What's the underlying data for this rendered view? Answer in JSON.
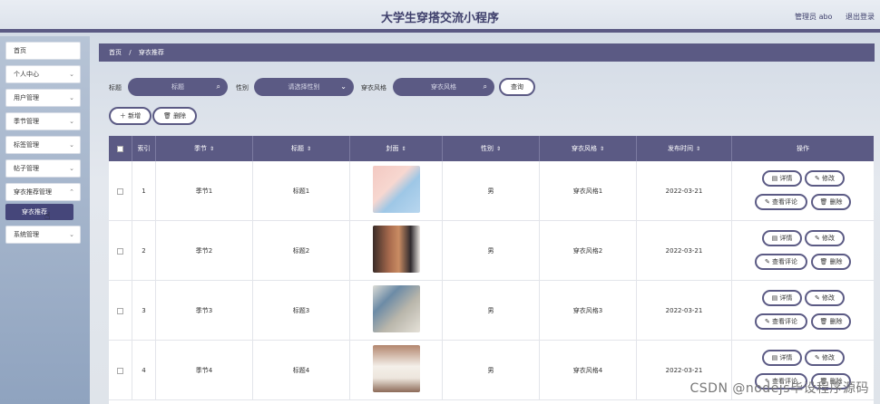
{
  "header": {
    "title": "大学生穿搭交流小程序",
    "admin": "管理员 abo",
    "logout": "退出登录"
  },
  "sidebar": {
    "items": [
      {
        "label": "首页"
      },
      {
        "label": "个人中心"
      },
      {
        "label": "用户管理"
      },
      {
        "label": "季节管理"
      },
      {
        "label": "标签管理"
      },
      {
        "label": "帖子管理"
      },
      {
        "label": "穿衣推荐管理"
      },
      {
        "label": "系统管理"
      }
    ],
    "active_sub": "穿衣推荐"
  },
  "breadcrumb": {
    "home": "首页",
    "sep": "/",
    "current": "穿衣推荐"
  },
  "filters": {
    "title_label": "标题",
    "title_placeholder": "标题",
    "gender_label": "性别",
    "gender_placeholder": "请选择性别",
    "style_label": "穿衣风格",
    "style_placeholder": "穿衣风格",
    "query_button": "查询"
  },
  "toolbar": {
    "add": "新增",
    "delete": "删除"
  },
  "table": {
    "headers": [
      "索引",
      "季节",
      "标题",
      "封面",
      "性别",
      "穿衣风格",
      "发布时间",
      "操作"
    ],
    "rows": [
      {
        "index": "1",
        "season": "季节1",
        "title": "标题1",
        "gender": "男",
        "style": "穿衣风格1",
        "date": "2022-03-21"
      },
      {
        "index": "2",
        "season": "季节2",
        "title": "标题2",
        "gender": "男",
        "style": "穿衣风格2",
        "date": "2022-03-21"
      },
      {
        "index": "3",
        "season": "季节3",
        "title": "标题3",
        "gender": "男",
        "style": "穿衣风格3",
        "date": "2022-03-21"
      },
      {
        "index": "4",
        "season": "季节4",
        "title": "标题4",
        "gender": "男",
        "style": "穿衣风格4",
        "date": "2022-03-21"
      }
    ],
    "actions": {
      "detail": "详情",
      "edit": "修改",
      "comments": "查看评论",
      "delete": "删除"
    }
  },
  "watermark": "CSDN @nodejs毕设程序源码",
  "colors": {
    "accent": "#5b5a84",
    "sidebar_active": "#45467a"
  }
}
